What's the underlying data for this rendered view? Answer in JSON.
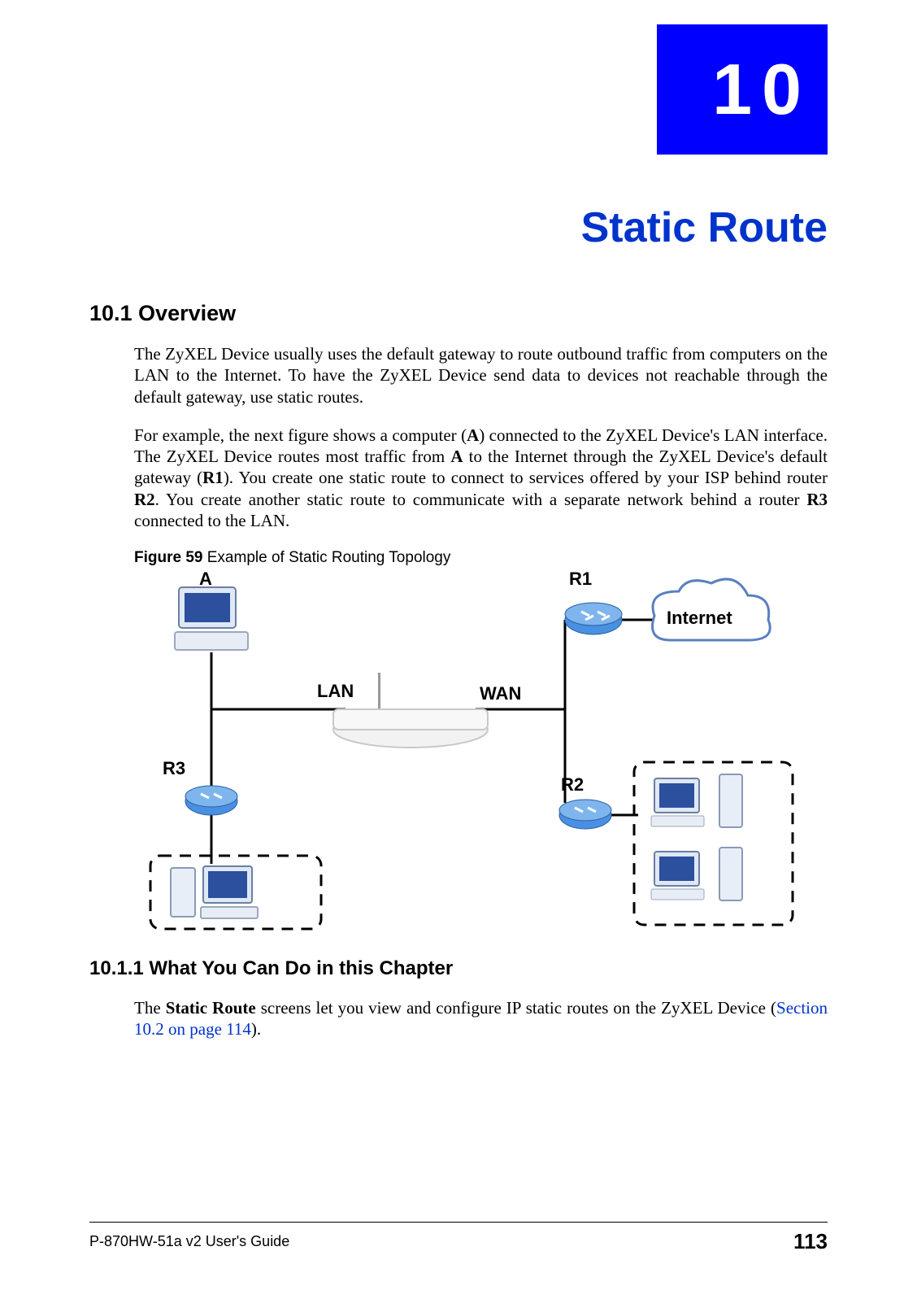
{
  "chapter_number": "10",
  "chapter_title": "Static Route",
  "section1": {
    "number_title": "10.1  Overview",
    "para1": "The ZyXEL Device usually uses the default gateway to route outbound traffic from computers on the LAN to the Internet. To have the ZyXEL Device send data to devices not reachable through the default gateway, use static routes.",
    "para2_a": "For example, the next figure shows a computer (",
    "para2_b": "A",
    "para2_c": ") connected to the ZyXEL Device's LAN interface. The ZyXEL Device routes most traffic from ",
    "para2_d": "A",
    "para2_e": " to the Internet through the ZyXEL Device's default gateway (",
    "para2_f": "R1",
    "para2_g": "). You create one static route to connect to services offered by your ISP behind router ",
    "para2_h": "R2",
    "para2_i": ". You create another static route to communicate with a separate network behind a router ",
    "para2_j": "R3",
    "para2_k": " connected to the LAN."
  },
  "figure": {
    "label_bold": "Figure 59",
    "label_rest": "   Example of Static Routing Topology",
    "labels": {
      "A": "A",
      "R1": "R1",
      "R2": "R2",
      "R3": "R3",
      "LAN": "LAN",
      "WAN": "WAN",
      "Internet": "Internet"
    }
  },
  "section2": {
    "number_title": "10.1.1  What You Can Do in this Chapter",
    "para_a": "The ",
    "para_b": "Static Route",
    "para_c": " screens let you view and configure IP static routes on the ZyXEL Device (",
    "para_link": "Section 10.2 on page 114",
    "para_d": ")."
  },
  "footer": {
    "guide": "P-870HW-51a v2 User's Guide",
    "page": "113"
  }
}
